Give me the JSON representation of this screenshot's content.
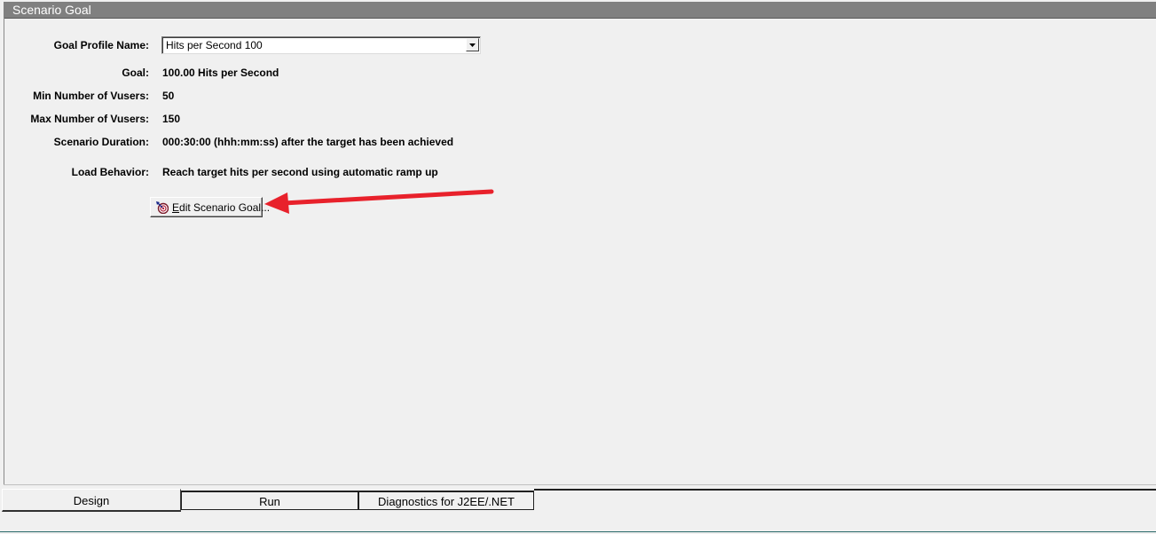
{
  "window": {
    "title": "Scenario Goal"
  },
  "form": {
    "goal_profile_label": "Goal Profile Name:",
    "goal_profile_value": "Hits per Second 100",
    "goal_label": "Goal:",
    "goal_value": "100.00 Hits per Second",
    "min_vusers_label": "Min Number of Vusers:",
    "min_vusers_value": "50",
    "max_vusers_label": "Max Number of Vusers:",
    "max_vusers_value": "150",
    "duration_label": "Scenario Duration:",
    "duration_value": "000:30:00 (hhh:mm:ss) after the target has been achieved",
    "load_behavior_label": "Load Behavior:",
    "load_behavior_value": "Reach target hits per second using automatic ramp up"
  },
  "edit_button": {
    "label_first": "E",
    "label_rest": "dit Scenario Goal...",
    "icon": "target-goal-icon"
  },
  "annotation": {
    "arrow_color": "#e8212b"
  },
  "tabs": [
    {
      "label": "Design",
      "active": true
    },
    {
      "label": "Run",
      "active": false
    },
    {
      "label": "Diagnostics for J2EE/.NET",
      "active": false
    }
  ],
  "colors": {
    "title_bar": "#808080",
    "background": "#f0f0f0"
  }
}
